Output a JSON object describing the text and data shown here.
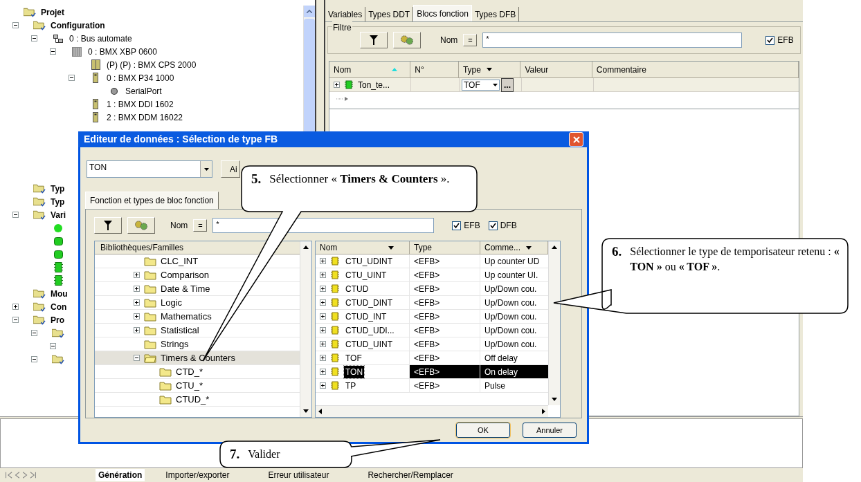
{
  "project_tree": [
    {
      "label": "Projet",
      "kind": "folder",
      "children": [
        {
          "label": "Configuration",
          "kind": "folder",
          "expanded": true,
          "children": [
            {
              "label": "0 : Bus automate",
              "kind": "bus",
              "expanded": true,
              "children": [
                {
                  "label": "0 : BMX XBP 0600",
                  "kind": "rack",
                  "expanded": true,
                  "children": [
                    {
                      "label": "(P) (P) : BMX CPS 2000",
                      "kind": "power"
                    },
                    {
                      "label": "0 : BMX P34 1000",
                      "kind": "module",
                      "expanded": true,
                      "children": [
                        {
                          "label": "SerialPort",
                          "kind": "port"
                        }
                      ]
                    },
                    {
                      "label": "1 : BMX DDI 1602",
                      "kind": "module"
                    },
                    {
                      "label": "2 : BMX DDM 16022",
                      "kind": "module"
                    }
                  ]
                }
              ]
            }
          ]
        },
        {
          "label": "Typ",
          "kind": "folder"
        },
        {
          "label": "Typ",
          "kind": "folder"
        },
        {
          "label": "Vari",
          "kind": "folder",
          "expanded": true,
          "children": [
            {
              "kind": "var-circle"
            },
            {
              "kind": "var-block"
            },
            {
              "kind": "var-block"
            },
            {
              "kind": "var-chip"
            },
            {
              "kind": "var-chip"
            }
          ]
        },
        {
          "label": "Mou",
          "kind": "folder"
        },
        {
          "label": "Con",
          "kind": "folder",
          "expanded": false
        },
        {
          "label": "Pro",
          "kind": "folder",
          "expanded": true,
          "children": [
            {
              "kind": "folder",
              "expanded": true,
              "children": [
                {
                  "kind": "blank",
                  "expanded": true
                }
              ]
            },
            {
              "kind": "folder",
              "expanded": true
            }
          ]
        }
      ]
    }
  ],
  "editor": {
    "tabs": [
      {
        "label": "Variables",
        "selected": false
      },
      {
        "label": "Types DDT",
        "selected": false
      },
      {
        "label": "Blocs fonction",
        "selected": true
      },
      {
        "label": "Types DFB",
        "selected": false
      }
    ],
    "filter": {
      "title": "Filtre",
      "name_label": "Nom",
      "operator": "=",
      "value": "*",
      "checkboxes": [
        {
          "label": "EFB",
          "checked": true
        }
      ]
    },
    "columns": [
      "Nom",
      "N°",
      "Type",
      "Valeur",
      "Commentaire"
    ],
    "rows": [
      {
        "name": "Ton_te...",
        "type": "TOF",
        "browse": "..."
      }
    ]
  },
  "dialog": {
    "title": "Editeur de données : Sélection de type FB",
    "combo_value": "TON",
    "add_button": "Ai",
    "tab": "Fonction et types de bloc fonction",
    "filter": {
      "name_label": "Nom",
      "operator": "=",
      "value": "*",
      "checkboxes": [
        {
          "label": "EFB",
          "checked": true
        },
        {
          "label": "DFB",
          "checked": true
        }
      ]
    },
    "library_header": "Bibliothèques/Familles",
    "libraries": [
      {
        "label": "CLC_INT",
        "selected": false
      },
      {
        "label": "Comparison",
        "expanded": false,
        "selected": false
      },
      {
        "label": "Date & Time",
        "expanded": false,
        "selected": false
      },
      {
        "label": "Logic",
        "expanded": false,
        "selected": false
      },
      {
        "label": "Mathematics",
        "expanded": false,
        "selected": false
      },
      {
        "label": "Statistical",
        "expanded": false,
        "selected": false
      },
      {
        "label": "Strings",
        "selected": false
      },
      {
        "label": "Timers & Counters",
        "expanded": true,
        "selected": true,
        "children": [
          {
            "label": "CTD_*",
            "selected": false
          },
          {
            "label": "CTU_*",
            "selected": false
          },
          {
            "label": "CTUD_*",
            "selected": false
          }
        ]
      }
    ],
    "columns": [
      "Nom",
      "Type",
      "Comme..."
    ],
    "blocks": [
      {
        "name": "CTU_UDINT",
        "type": "<EFB>",
        "comment": "Up counter UD",
        "selected": false
      },
      {
        "name": "CTU_UINT",
        "type": "<EFB>",
        "comment": "Up counter UI.",
        "selected": false
      },
      {
        "name": "CTUD",
        "type": "<EFB>",
        "comment": "Up/Down cou.",
        "selected": false
      },
      {
        "name": "CTUD_DINT",
        "type": "<EFB>",
        "comment": "Up/Down cou.",
        "selected": false
      },
      {
        "name": "CTUD_INT",
        "type": "<EFB>",
        "comment": "Up/Down cou.",
        "selected": false
      },
      {
        "name": "CTUD_UDI...",
        "type": "<EFB>",
        "comment": "Up/Down cou.",
        "selected": false
      },
      {
        "name": "CTUD_UINT",
        "type": "<EFB>",
        "comment": "Up/Down cou.",
        "selected": false
      },
      {
        "name": "TOF",
        "type": "<EFB>",
        "comment": "Off delay",
        "selected": false
      },
      {
        "name": "TON",
        "type": "<EFB>",
        "comment": "On delay",
        "selected": true
      },
      {
        "name": "TP",
        "type": "<EFB>",
        "comment": "Pulse",
        "selected": false
      }
    ],
    "buttons": [
      "OK",
      "Annuler"
    ]
  },
  "output_tabs": [
    {
      "label": "Génération",
      "selected": true
    },
    {
      "label": "Importer/exporter",
      "selected": false
    },
    {
      "label": "Erreur utilisateur",
      "selected": false
    },
    {
      "label": "Rechercher/Remplacer",
      "selected": false
    }
  ],
  "callouts": [
    {
      "number": "5.",
      "text": "Sélectionner « **Timers & Counters** »."
    },
    {
      "number": "6.",
      "text": "Sélectionner le type de temporisateur retenu : **« TON »** ou **« TOF »**."
    },
    {
      "number": "7.",
      "text": "Valider"
    }
  ]
}
